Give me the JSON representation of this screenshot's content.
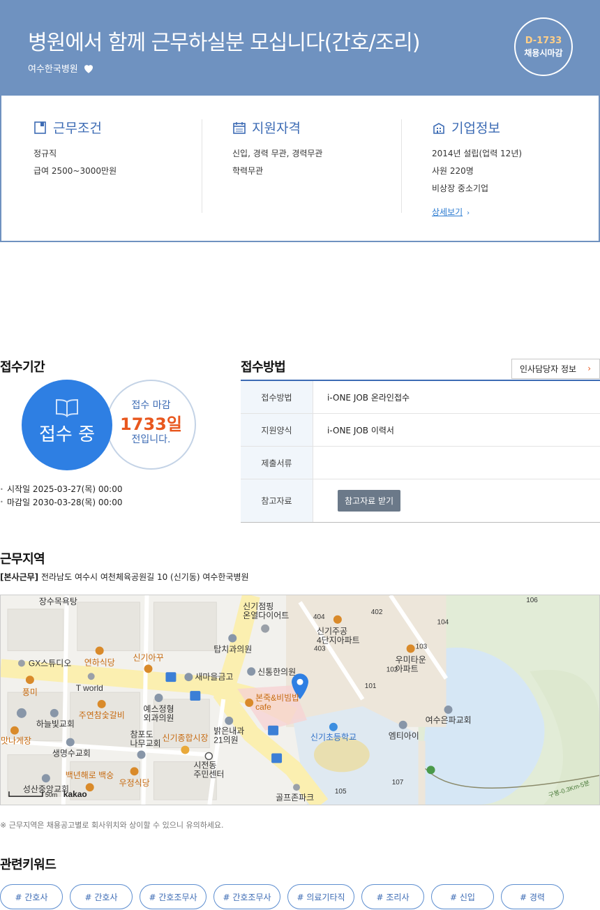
{
  "header": {
    "title": "병원에서 함께 근무하실분 모십니다(간호/조리)",
    "company": "여수한국병원",
    "dday": "D-1733",
    "deadline_label": "채용시마감"
  },
  "summary": {
    "conditions": {
      "title": "근무조건",
      "lines": [
        "정규직",
        "급여 2500~3000만원"
      ]
    },
    "qualifications": {
      "title": "지원자격",
      "lines": [
        "신입, 경력 무관, 경력무관",
        "학력무관"
      ]
    },
    "company": {
      "title": "기업정보",
      "lines": [
        "2014년 설립(업력 12년)",
        "사원 220명",
        "비상장 중소기업"
      ],
      "more": "상세보기"
    }
  },
  "period": {
    "title": "접수기간",
    "status": "접수 중",
    "ring_top": "접수 마감",
    "ring_days": "1733일",
    "ring_bottom": "전입니다.",
    "start": "시작일 2025-03-27(목) 00:00",
    "end": "마감일 2030-03-28(목) 00:00"
  },
  "method": {
    "title": "접수방법",
    "hr_button": "인사담당자 정보",
    "rows": [
      {
        "key": "접수방법",
        "value": "i-ONE JOB 온라인접수"
      },
      {
        "key": "지원양식",
        "value": "i-ONE JOB 이력서"
      },
      {
        "key": "제출서류",
        "value": ""
      },
      {
        "key": "참고자료",
        "value": ""
      }
    ],
    "ref_button": "참고자료 받기"
  },
  "location": {
    "title": "근무지역",
    "tag": "[본사근무]",
    "address": "전라남도 여수시 여천체육공원길 10 (신기동) 여수한국병원",
    "notice": "※ 근무지역은 채용공고별로 회사위치와 상이할 수 있으니 유의하세요.",
    "map_labels": {
      "bathhouse": "장수목욕탕",
      "gx": "GX스튜디오",
      "yeonha": "연하식당",
      "singi_akku": "신기아꾸",
      "tworld": "T world",
      "pungmi": "풍미",
      "haneulbit": "하늘빛교회",
      "juyeon": "주연참숯갈비",
      "saengmyeong": "생명수교회",
      "matna": "맛나게장",
      "backnyeon": "백년해로 백숭",
      "ujeong": "우정식당",
      "seongsan": "성산중앙교회",
      "yesu": "예스정형\n외과의원",
      "champodo": "참포도\n나무교회",
      "singi_market": "신기종합시장",
      "saemaeul": "새마을금고",
      "tapchi": "탑치과의원",
      "singi_champing": "신기점핑\n온열다이어트",
      "sintong": "신통한의원",
      "bonjuk": "본죽&비빔밥\ncafe",
      "balgeun": "밝은내과\n21의원",
      "sijeon": "시전동\n주민센터",
      "golf": "골프존파크",
      "singi_elem": "신기초등학교",
      "emti": "엠티아이",
      "yeosu_church": "여수은파교회",
      "umitown": "우미타운\n아파트",
      "singijugong": "신기주공\n4단지아파트",
      "apt_101": "101",
      "apt_102": "102",
      "apt_103": "103",
      "apt_104": "104",
      "apt_105": "105",
      "apt_106": "106",
      "apt_107": "107",
      "apt_402": "402",
      "apt_403": "403",
      "apt_404": "404",
      "scale": "50m",
      "kakao": "kakao",
      "trail": "구봉-0.3Km-5분"
    }
  },
  "keywords": {
    "title": "관련키워드",
    "items": [
      "# 간호사",
      "# 간호사",
      "# 간호조무사",
      "# 간호조무사",
      "# 의료기타직",
      "# 조리사",
      "# 신입",
      "# 경력"
    ]
  },
  "colors": {
    "header_bg": "#6f92c0",
    "accent_blue": "#2e7fe3",
    "accent_orange": "#e8571e"
  }
}
